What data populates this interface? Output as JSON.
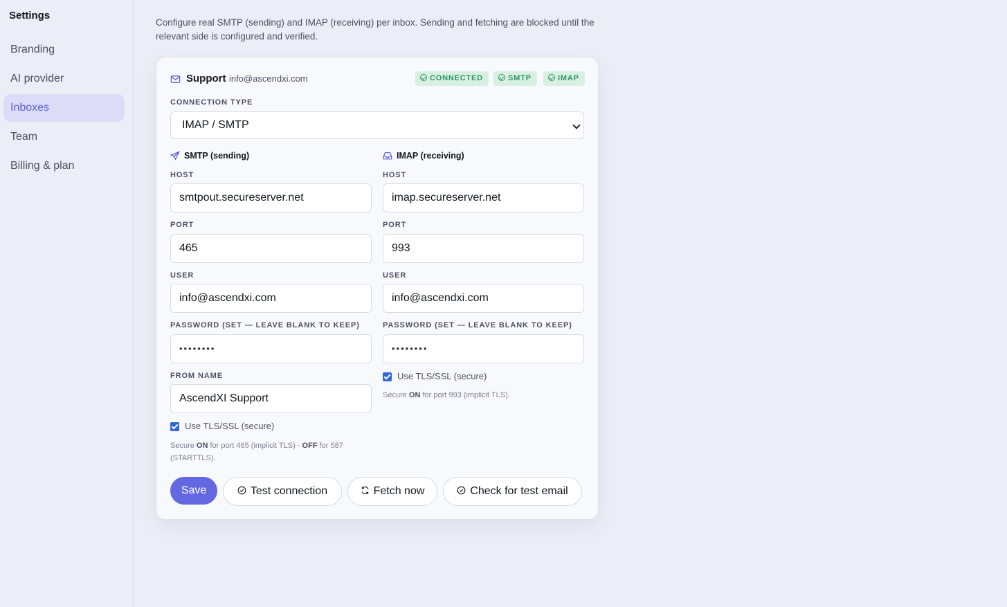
{
  "sidebar": {
    "title": "Settings",
    "items": [
      {
        "label": "Branding"
      },
      {
        "label": "AI provider"
      },
      {
        "label": "Inboxes",
        "active": true
      },
      {
        "label": "Team"
      },
      {
        "label": "Billing & plan"
      }
    ]
  },
  "intro": "Configure real SMTP (sending) and IMAP (receiving) per inbox. Sending and fetching are blocked until the relevant side is configured and verified.",
  "inbox": {
    "name": "Support",
    "email": "info@ascendxi.com",
    "icon": "mail-icon",
    "badges": [
      "CONNECTED",
      "SMTP",
      "IMAP"
    ]
  },
  "connection": {
    "label": "CONNECTION TYPE",
    "value": "IMAP / SMTP"
  },
  "smtp": {
    "title": "SMTP (sending)",
    "icon": "send-icon",
    "host_label": "HOST",
    "host": "smtpout.secureserver.net",
    "port_label": "PORT",
    "port": "465",
    "user_label": "USER",
    "user": "info@ascendxi.com",
    "password_label": "PASSWORD (SET — LEAVE BLANK TO KEEP)",
    "password": "••••••••",
    "from_label": "FROM NAME",
    "from_name": "AscendXI Support",
    "tls_label": "Use TLS/SSL (secure)",
    "tls_checked": true,
    "hint_1": "Secure ",
    "hint_on": "ON",
    "hint_2": " for port 465 (implicit TLS) · ",
    "hint_off": "OFF",
    "hint_3": " for 587",
    "hint_4": "(STARTTLS)."
  },
  "imap": {
    "title": "IMAP (receiving)",
    "icon": "inbox-icon",
    "host_label": "HOST",
    "host": "imap.secureserver.net",
    "port_label": "PORT",
    "port": "993",
    "user_label": "USER",
    "user": "info@ascendxi.com",
    "password_label": "PASSWORD (SET — LEAVE BLANK TO KEEP)",
    "password": "••••••••",
    "tls_label": "Use TLS/SSL (secure)",
    "tls_checked": true,
    "hint_1": "Secure ",
    "hint_on": "ON",
    "hint_2": " for port 993 (implicit TLS)."
  },
  "actions": {
    "save": "Save",
    "test": "Test connection",
    "fetch": "Fetch now",
    "check": "Check for test email"
  },
  "colors": {
    "accent": "#6468e0",
    "badge_bg": "#d8f0e2",
    "badge_fg": "#2e9462",
    "nav_active_bg": "#dcdcf6"
  }
}
